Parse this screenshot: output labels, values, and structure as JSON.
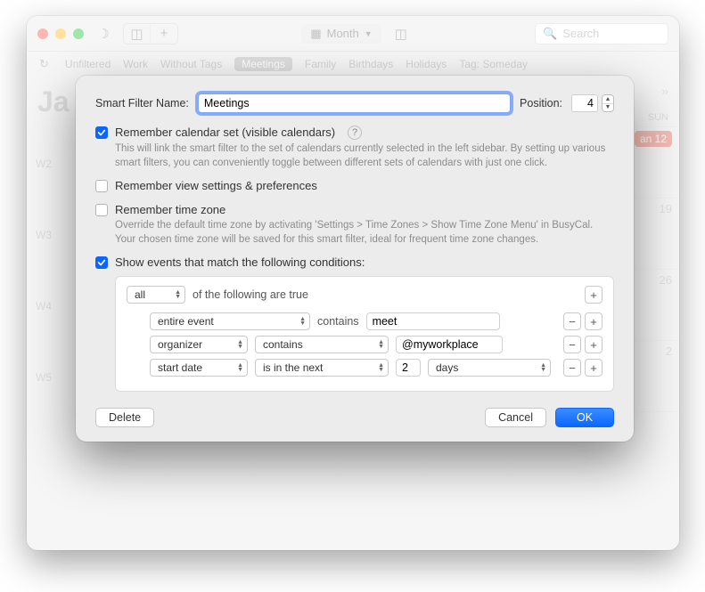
{
  "bg": {
    "month_view_label": "Month",
    "search_placeholder": "Search",
    "month_label": "Ja",
    "filter_tabs": [
      "Unfiltered",
      "Work",
      "Without Tags",
      "Meetings",
      "Family",
      "Birthdays",
      "Holidays",
      "Tag: Someday"
    ],
    "filter_selected_index": 3,
    "week_labels": [
      "W2",
      "W3",
      "W4",
      "W5"
    ],
    "day_headers": [
      "SUN"
    ],
    "today_label": "an 12",
    "trailing_days_col7": [
      "19",
      "26",
      "2"
    ]
  },
  "modal": {
    "name_label": "Smart Filter Name:",
    "name_value": "Meetings",
    "position_label": "Position:",
    "position_value": "4",
    "opt_remember_calset": {
      "label": "Remember calendar set (visible calendars)",
      "checked": true,
      "help": "?",
      "desc": "This will link the smart filter to the set of calendars currently selected in the left sidebar. By setting up various smart filters, you can conveniently toggle between different sets of calendars with just one click."
    },
    "opt_remember_view": {
      "label": "Remember view settings & preferences",
      "checked": false
    },
    "opt_remember_tz": {
      "label": "Remember time zone",
      "checked": false,
      "desc": "Override the default time zone by activating 'Settings > Time Zones > Show Time Zone Menu' in BusyCal. Your chosen time zone will be saved for this smart filter, ideal for frequent time zone changes."
    },
    "opt_conditions": {
      "label": "Show events that match the following conditions:",
      "checked": true
    },
    "predicate": {
      "compound_scope": "all",
      "compound_suffix": "of the following are true",
      "rows": [
        {
          "field": "entire event",
          "field_width": 180,
          "op": "contains",
          "op_is_select": false,
          "value": "meet",
          "value_width": 150
        },
        {
          "field": "organizer",
          "field_width": 110,
          "op": "contains",
          "op_is_select": true,
          "op_width": 150,
          "value": "@myworkplace",
          "value_width": 120
        },
        {
          "field": "start date",
          "field_width": 110,
          "op": "is in the next",
          "op_is_select": true,
          "op_width": 150,
          "number": "2",
          "unit": "days",
          "unit_width": 138
        }
      ]
    },
    "buttons": {
      "delete": "Delete",
      "cancel": "Cancel",
      "ok": "OK"
    }
  }
}
